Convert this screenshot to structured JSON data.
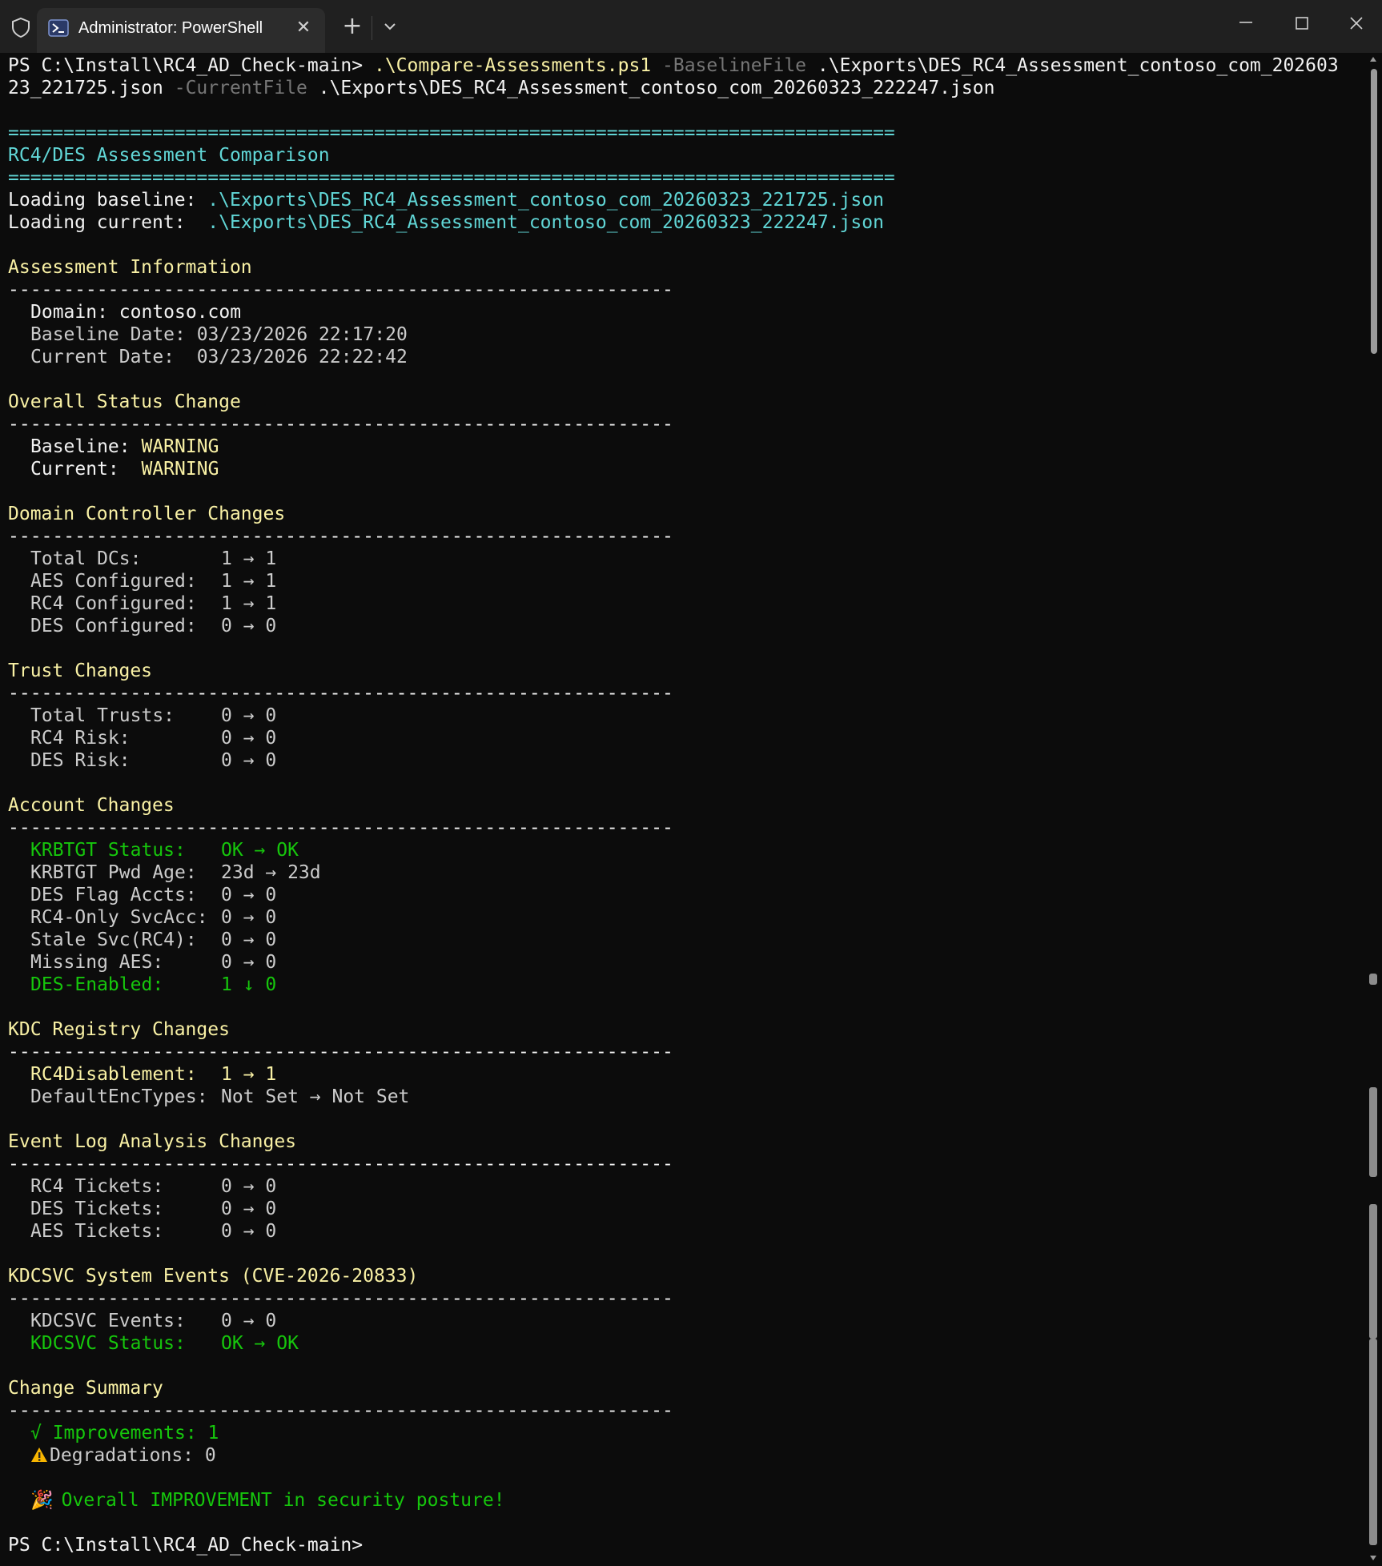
{
  "window": {
    "tab_title": "Administrator: PowerShell",
    "close_tab_glyph": "✕",
    "new_tab_glyph": "+",
    "colors": {
      "background": "#0c0c0c",
      "titlebar": "#202020",
      "tab": "#2c2c2c",
      "cyan": "#61d6d6",
      "yellow": "#f9f1a5",
      "green": "#16c60c"
    }
  },
  "terminal": {
    "command": {
      "prompt": "PS C:\\Install\\RC4_AD_Check-main> ",
      "script": ".\\Compare-Assessments.ps1",
      "param1": " -BaselineFile",
      "arg1_part1": " .\\Exports\\DES_RC4_Assessment_contoso_com_202603",
      "arg1_part2": "23_221725.json",
      "param2": " -CurrentFile",
      "arg2": " .\\Exports\\DES_RC4_Assessment_contoso_com_20260323_222247.json"
    },
    "rule": "================================================================================",
    "dash_rule": "------------------------------------------------------------",
    "heading": "RC4/DES Assessment Comparison",
    "loading": [
      {
        "label": "Loading baseline: ",
        "path": ".\\Exports\\DES_RC4_Assessment_contoso_com_20260323_221725.json"
      },
      {
        "label": "Loading current:  ",
        "path": ".\\Exports\\DES_RC4_Assessment_contoso_com_20260323_222247.json"
      }
    ],
    "assessment_info": {
      "title": "Assessment Information",
      "domain_label": "Domain: ",
      "domain_value": "contoso.com",
      "baseline_date": "Baseline Date: 03/23/2026 22:17:20",
      "current_date": "Current Date:  03/23/2026 22:22:42"
    },
    "overall_status": {
      "title": "Overall Status Change",
      "baseline_label": "Baseline: ",
      "baseline_value": "WARNING",
      "current_label": "Current:  ",
      "current_value": "WARNING"
    },
    "dc_changes": {
      "title": "Domain Controller Changes",
      "rows": [
        {
          "label": "Total DCs:",
          "value": "1 → 1"
        },
        {
          "label": "AES Configured:",
          "value": "1 → 1"
        },
        {
          "label": "RC4 Configured:",
          "value": "1 → 1"
        },
        {
          "label": "DES Configured:",
          "value": "0 → 0"
        }
      ]
    },
    "trust_changes": {
      "title": "Trust Changes",
      "rows": [
        {
          "label": "Total Trusts:",
          "value": "0 → 0"
        },
        {
          "label": "RC4 Risk:",
          "value": "0 → 0"
        },
        {
          "label": "DES Risk:",
          "value": "0 → 0"
        }
      ]
    },
    "account_changes": {
      "title": "Account Changes",
      "rows": [
        {
          "label": "KRBTGT Status:",
          "value": "OK → OK"
        },
        {
          "label": "KRBTGT Pwd Age:",
          "value": "23d → 23d"
        },
        {
          "label": "DES Flag Accts:",
          "value": "0 → 0"
        },
        {
          "label": "RC4-Only SvcAcc:",
          "value": "0 → 0"
        },
        {
          "label": "Stale Svc(RC4):",
          "value": "0 → 0"
        },
        {
          "label": "Missing AES:",
          "value": "0 → 0"
        },
        {
          "label": "DES-Enabled:",
          "value": "1 ↓ 0"
        }
      ]
    },
    "kdc_registry": {
      "title": "KDC Registry Changes",
      "rows": [
        {
          "label": "RC4Disablement:",
          "value": "1 → 1"
        },
        {
          "label": "DefaultEncTypes:",
          "value": "Not Set → Not Set"
        }
      ]
    },
    "event_log": {
      "title": "Event Log Analysis Changes",
      "rows": [
        {
          "label": "RC4 Tickets:",
          "value": "0 → 0"
        },
        {
          "label": "DES Tickets:",
          "value": "0 → 0"
        },
        {
          "label": "AES Tickets:",
          "value": "0 → 0"
        }
      ]
    },
    "kdcsvc": {
      "title": "KDCSVC System Events (CVE-2026-20833)",
      "rows": [
        {
          "label": "KDCSVC Events:",
          "value": "0 → 0"
        },
        {
          "label": "KDCSVC Status:",
          "value": "OK → OK"
        }
      ]
    },
    "summary": {
      "title": "Change Summary",
      "improvements": "√ Improvements: 1",
      "degradations": "Degradations: 0",
      "party_glyph": "🎉",
      "overall": "Overall IMPROVEMENT in security posture!"
    },
    "final_prompt": "PS C:\\Install\\RC4_AD_Check-main>"
  }
}
